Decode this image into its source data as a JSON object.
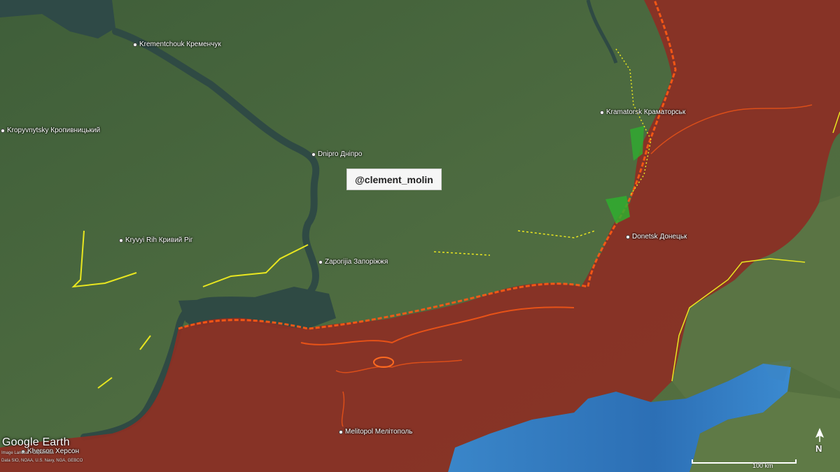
{
  "map": {
    "watermark": "@clement_molin",
    "logo": "Google Earth",
    "attribution": [
      "Image Landsat / Copernicus",
      "Data SIO, NOAA, U.S. Navy, NGA, GEBCO"
    ],
    "scale_label": "100 km",
    "compass_label": "N",
    "colors": {
      "land": "#4a6a3e",
      "occupied": "#8c2f24",
      "frontline": "#ff5a14",
      "fortifications": "#e8e620",
      "contested": "#2fae2f",
      "sea": "#2f78c2",
      "river": "#2f4a44"
    },
    "cities": [
      {
        "id": "kremenchuk",
        "label": "Krementchouk Кременчук"
      },
      {
        "id": "kropyvnytsky",
        "label": "Kropyvnytsky Кропивницький"
      },
      {
        "id": "dnipro",
        "label": "Dnipro Дніпро"
      },
      {
        "id": "kramatorsk",
        "label": "Kramatorsk Краматорськ"
      },
      {
        "id": "kryvyi-rih",
        "label": "Kryvyi Rih Кривий Ріг"
      },
      {
        "id": "zaporijia",
        "label": "Zaporijia Запоріжжя"
      },
      {
        "id": "donetsk",
        "label": "Donetsk Донецьк"
      },
      {
        "id": "melitopol",
        "label": "Melitopol Мелітополь"
      },
      {
        "id": "kherson",
        "label": "Kherson Херсон"
      }
    ]
  }
}
